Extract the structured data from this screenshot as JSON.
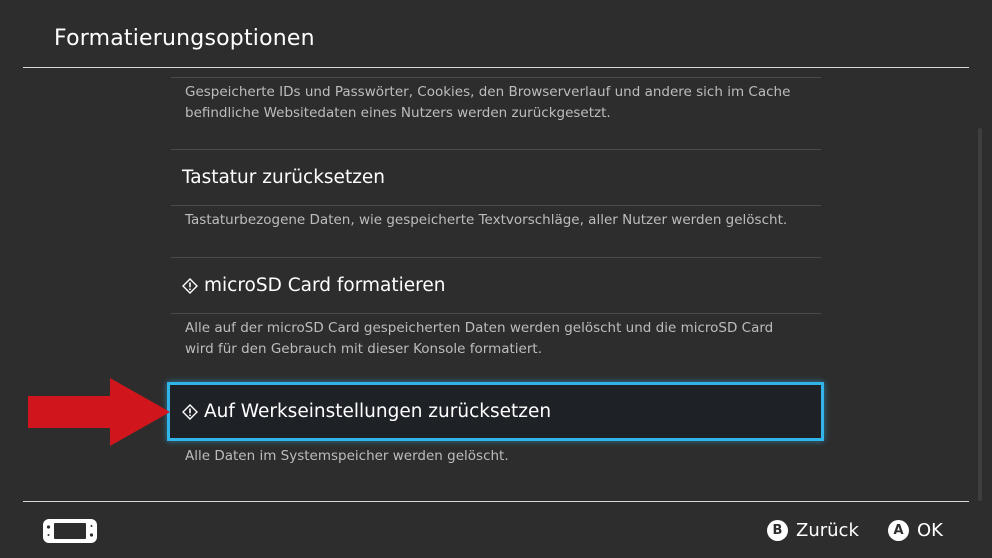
{
  "header": {
    "title": "Formatierungsoptionen"
  },
  "items": [
    {
      "desc_lines": [
        "Gespeicherte IDs und Passwörter, Cookies, den Browserverlauf und andere sich im Cache",
        "befindliche Websitedaten eines Nutzers werden zurückgesetzt."
      ]
    },
    {
      "label": "Tastatur zurücksetzen",
      "icon": "",
      "desc_lines": [
        "Tastaturbezogene Daten, wie gespeicherte Textvorschläge, aller Nutzer werden gelöscht."
      ]
    },
    {
      "label": "microSD Card formatieren",
      "icon": "warning-diamond-icon",
      "desc_lines": [
        "Alle auf der microSD Card gespeicherten Daten werden gelöscht und die microSD Card",
        "wird für den Gebrauch mit dieser Konsole formatiert."
      ]
    },
    {
      "label": "Auf Werkseinstellungen zurücksetzen",
      "icon": "warning-diamond-icon",
      "selected": true,
      "desc_lines": [
        "Alle Daten im Systemspeicher werden gelöscht."
      ]
    }
  ],
  "footer": {
    "back": {
      "glyph": "B",
      "label": "Zurück"
    },
    "ok": {
      "glyph": "A",
      "label": "OK"
    }
  },
  "colors": {
    "background": "#2d2d2d",
    "selection_border": "#31b4e8",
    "annotation_arrow": "#d0161c"
  }
}
